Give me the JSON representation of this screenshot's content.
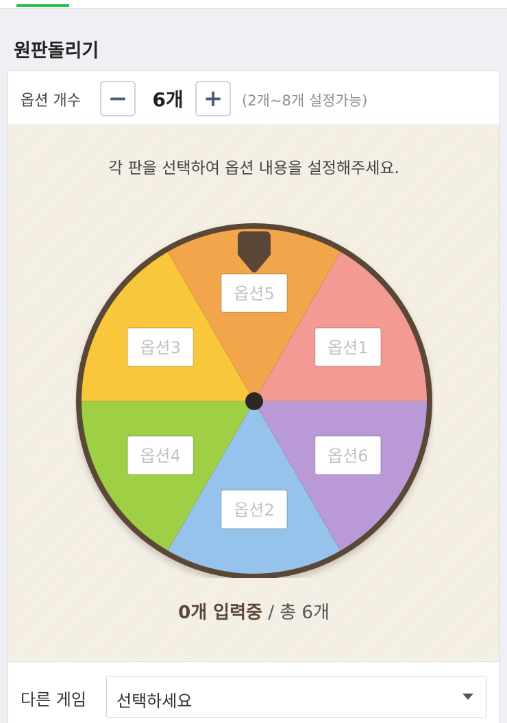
{
  "header": {
    "title": "원판돌리기"
  },
  "options": {
    "label": "옵션 개수",
    "minus": "−",
    "plus": "+",
    "count_display": "6개",
    "count": 6,
    "range_hint": "(2개~8개 설정가능)"
  },
  "board": {
    "instruction": "각 판을 선택하여 옵션 내용을 설정해주세요."
  },
  "wheel": {
    "segments": [
      {
        "placeholder": "옵션1",
        "color": "#f49a94"
      },
      {
        "placeholder": "옵션5",
        "color": "#f2a54a"
      },
      {
        "placeholder": "옵션3",
        "color": "#f8c73c"
      },
      {
        "placeholder": "옵션4",
        "color": "#9fcf45"
      },
      {
        "placeholder": "옵션2",
        "color": "#96c3ec"
      },
      {
        "placeholder": "옵션6",
        "color": "#b99ad6"
      }
    ],
    "rim_color": "#5a4636"
  },
  "status": {
    "entered": "0개 입력중",
    "separator": " / ",
    "total": "총 6개"
  },
  "footer": {
    "other_game_label": "다른 게임",
    "select_value": "선택하세요"
  }
}
